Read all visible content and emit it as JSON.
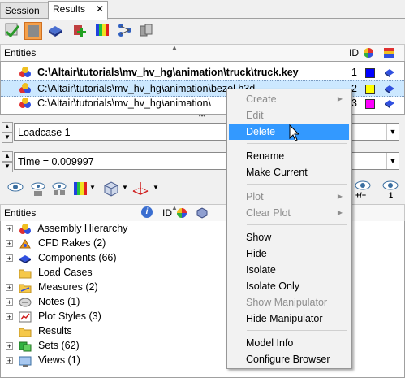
{
  "tabs": [
    {
      "label": "Session",
      "active": false
    },
    {
      "label": "Results",
      "active": true
    }
  ],
  "tab_close_glyph": "✕",
  "toolbar_icons": [
    "checkmark-open-icon",
    "folder-icon",
    "model-icon",
    "add-results-icon",
    "contour-icon",
    "network-icon",
    "cylinders-icon"
  ],
  "entities_header": {
    "label": "Entities",
    "id_label": "ID"
  },
  "files": [
    {
      "path": "C:\\Altair\\tutorials\\mv_hv_hg\\animation\\truck\\truck.key",
      "id": "1",
      "color": "#0000ff",
      "bold": true,
      "selected": false
    },
    {
      "path": "C:\\Altair\\tutorials\\mv_hv_hg\\animation\\bezel.h3d",
      "id": "2",
      "color": "#ffff00",
      "bold": false,
      "selected": true
    },
    {
      "path": "C:\\Altair\\tutorials\\mv_hv_hg\\animation\\",
      "id": "3",
      "color": "#ff00ff",
      "bold": false,
      "selected": false
    }
  ],
  "loadcase": {
    "value": "Loadcase 1"
  },
  "time": {
    "value": "Time = 0.009997"
  },
  "tree_header": {
    "label": "Entities",
    "id_label": "ID"
  },
  "tree": [
    {
      "label": "Assembly Hierarchy",
      "icon": "assembly-icon"
    },
    {
      "label": "CFD Rakes (2)",
      "icon": "cfd-rakes-icon"
    },
    {
      "label": "Components (66)",
      "icon": "components-icon"
    },
    {
      "label": "Load Cases",
      "icon": "folder-icon"
    },
    {
      "label": "Measures (2)",
      "icon": "measures-icon"
    },
    {
      "label": "Notes (1)",
      "icon": "notes-icon"
    },
    {
      "label": "Plot Styles (3)",
      "icon": "plot-styles-icon"
    },
    {
      "label": "Results",
      "icon": "folder-icon"
    },
    {
      "label": "Sets (62)",
      "icon": "sets-icon"
    },
    {
      "label": "Views (1)",
      "icon": "views-icon"
    }
  ],
  "context_menu": {
    "items": [
      {
        "label": "Create",
        "disabled": true,
        "submenu": true
      },
      {
        "label": "Edit",
        "disabled": true,
        "submenu": false
      },
      {
        "label": "Delete",
        "disabled": false,
        "submenu": false,
        "highlighted": true
      },
      {
        "label": "Rename",
        "disabled": false,
        "submenu": false
      },
      {
        "label": "Make Current",
        "disabled": false,
        "submenu": false
      },
      {
        "label": "Plot",
        "disabled": true,
        "submenu": true
      },
      {
        "label": "Clear Plot",
        "disabled": true,
        "submenu": true
      },
      {
        "label": "Show",
        "disabled": false,
        "submenu": false
      },
      {
        "label": "Hide",
        "disabled": false,
        "submenu": false
      },
      {
        "label": "Isolate",
        "disabled": false,
        "submenu": false
      },
      {
        "label": "Isolate Only",
        "disabled": false,
        "submenu": false
      },
      {
        "label": "Show Manipulator",
        "disabled": true,
        "submenu": false
      },
      {
        "label": "Hide Manipulator",
        "disabled": false,
        "submenu": false
      },
      {
        "label": "Model Info",
        "disabled": false,
        "submenu": false
      },
      {
        "label": "Configure Browser",
        "disabled": false,
        "submenu": false
      }
    ]
  },
  "colors": {
    "highlight": "#3399ff",
    "selected_row": "#cce8ff"
  }
}
